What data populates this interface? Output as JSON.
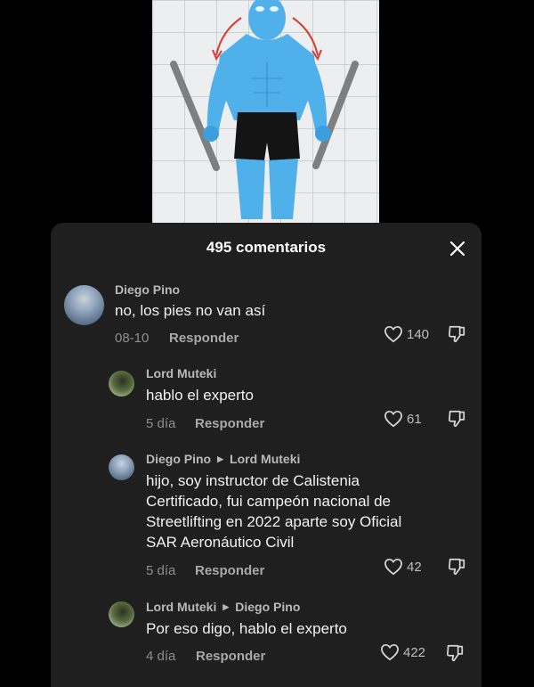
{
  "sheet": {
    "title": "495 comentarios"
  },
  "comments": [
    {
      "author": "Diego Pino",
      "reply_to": "",
      "text": "no, los pies no van así",
      "date": "08-10",
      "reply_label": "Responder",
      "likes": "140"
    },
    {
      "author": "Lord Muteki",
      "reply_to": "",
      "text": "hablo el experto",
      "date": "5 día",
      "reply_label": "Responder",
      "likes": "61"
    },
    {
      "author": "Diego Pino",
      "reply_to": "Lord Muteki",
      "text_lines": [
        "hijo, soy instructor de Calistenia",
        "Certificado, fui campeón nacional de",
        "Streetlifting en 2022 aparte soy Oficial",
        "SAR Aeronáutico Civil"
      ],
      "date": "5 día",
      "reply_label": "Responder",
      "likes": "42"
    },
    {
      "author": "Lord Muteki",
      "reply_to": "Diego Pino",
      "text": "Por eso digo, hablo el experto",
      "date": "4 día",
      "reply_label": "Responder",
      "likes": "422"
    }
  ],
  "icons": {
    "close": "close-icon",
    "like": "heart-icon",
    "dislike": "thumb-down-icon",
    "reply_arrow": "caret-right-icon"
  },
  "colors": {
    "sheet_bg": "#1f1f1f",
    "page_bg": "#000000",
    "figure": "#4fb0ea"
  }
}
